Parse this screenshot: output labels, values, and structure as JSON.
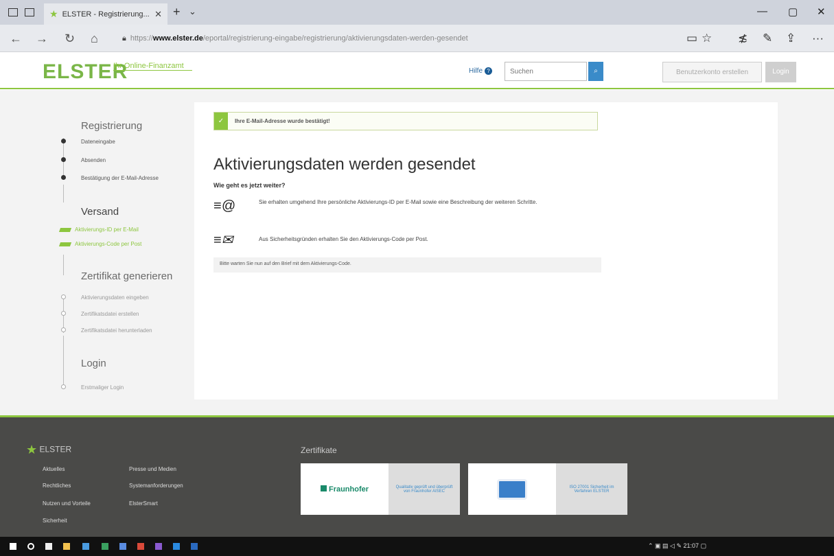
{
  "browser": {
    "tab_title": "ELSTER - Registrierung...",
    "url_domain": "www.elster.de",
    "url_prefix": "https://",
    "url_path": "/eportal/registrierung-eingabe/registrierung/aktivierungsdaten-werden-gesendet",
    "window_minimize": "—",
    "window_maximize": "▢",
    "window_close": "✕",
    "more": "···"
  },
  "header": {
    "logo": "ELSTER",
    "logo_subtitle": "Ihr Online-Finanzamt",
    "help_label": "Hilfe",
    "search_placeholder": "Suchen",
    "register_button": "Benutzerkonto erstellen",
    "login_button": "Login"
  },
  "sidebar": {
    "registrierung_title": "Registrierung",
    "registrierung_steps": [
      "Dateneingabe",
      "Absenden",
      "Bestätigung der E-Mail-Adresse"
    ],
    "versand_title": "Versand",
    "versand_steps": [
      "Aktivierungs-ID per E-Mail",
      "Aktivierungs-Code per Post"
    ],
    "zertifikat_title": "Zertifikat generieren",
    "zertifikat_steps": [
      "Aktivierungsdaten eingeben",
      "Zertifikatsdatei erstellen",
      "Zertifikatsdatei herunterladen"
    ],
    "login_title": "Login",
    "login_steps": [
      "Erstmaliger Login"
    ]
  },
  "content": {
    "success_message": "Ihre E-Mail-Adresse wurde bestätigt!",
    "title": "Aktivierungsdaten werden gesendet",
    "subheading": "Wie geht es jetzt weiter?",
    "email_info": "Sie erhalten umgehend Ihre persönliche Aktivierungs-ID per E-Mail sowie eine Beschreibung der weiteren Schritte.",
    "post_info": "Aus Sicherheitsgründen erhalten Sie den Aktivierungs-Code per Post.",
    "note": "Bitte warten Sie nun auf den Brief mit dem Aktivierungs-Code."
  },
  "footer": {
    "logo": "ELSTER",
    "links_col1": [
      "Aktuelles",
      "Rechtliches",
      "Nutzen und Vorteile",
      "Sicherheit"
    ],
    "links_col2": [
      "Presse und Medien",
      "Systemanforderungen",
      "ElsterSmart"
    ],
    "certs_title": "Zertifikate",
    "cert1_logo": "Fraunhofer",
    "cert1_text": "Qualitativ geprüft und überprüft von Fraunhofer AISEC",
    "cert2_text": "ISO 27001 Sicherheit im Verfahren ELSTER"
  },
  "taskbar": {
    "clock": "21:07"
  }
}
